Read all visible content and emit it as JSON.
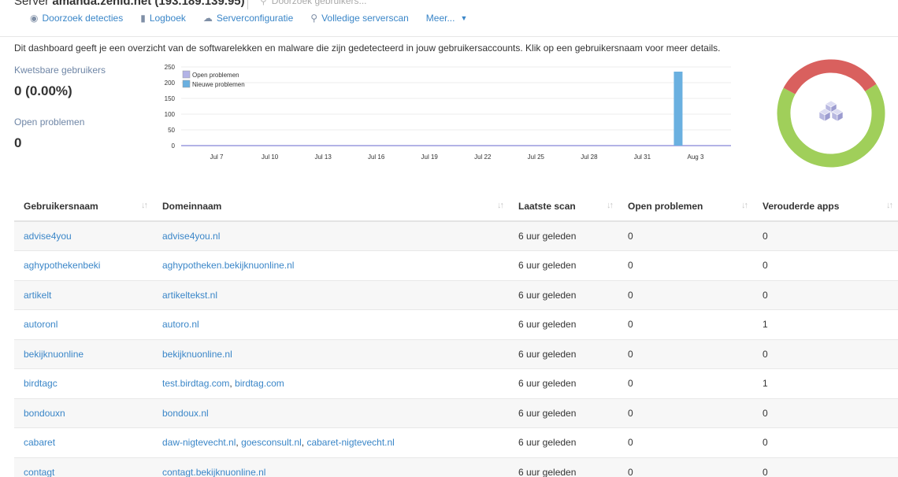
{
  "header": {
    "server_prefix": "Server ",
    "server_name": "amanda.zenid.net (193.189.139.95)",
    "search_placeholder": "Doorzoek gebruikers...",
    "nav": [
      {
        "label": "Doorzoek detecties",
        "icon": "eye-icon"
      },
      {
        "label": "Logboek",
        "icon": "book-icon"
      },
      {
        "label": "Serverconfiguratie",
        "icon": "cloud-icon"
      },
      {
        "label": "Volledige serverscan",
        "icon": "search-icon"
      },
      {
        "label": "Meer...",
        "icon": "caret-down-icon"
      }
    ]
  },
  "intro": "Dit dashboard geeft je een overzicht van de softwarelekken en malware die zijn gedetecteerd in jouw gebruikersaccounts. Klik op een gebruikersnaam voor meer details.",
  "stats": {
    "vulnerable_label": "Kwetsbare gebruikers",
    "vulnerable_value": "0 (0.00%)",
    "open_label": "Open problemen",
    "open_value": "0"
  },
  "colors": {
    "link": "#3a86c8",
    "open_series": "#b3b3e6",
    "new_series": "#6ab0e0",
    "donut_green": "#a0cf5a",
    "donut_red": "#d9605e"
  },
  "chart_data": {
    "type": "bar",
    "title": "",
    "ylim": [
      0,
      250
    ],
    "yticks": [
      0,
      50,
      100,
      150,
      200,
      250
    ],
    "xticks": [
      "Jul 7",
      "Jul 10",
      "Jul 13",
      "Jul 16",
      "Jul 19",
      "Jul 22",
      "Jul 25",
      "Jul 28",
      "Jul 31",
      "Aug 3"
    ],
    "legend_position": "top-left",
    "series": [
      {
        "name": "Open problemen",
        "points": [
          {
            "x": "Jul 5",
            "y": 0
          },
          {
            "x": "Aug 5",
            "y": 0
          }
        ]
      },
      {
        "name": "Nieuwe problemen",
        "points": [
          {
            "x": "Aug 2",
            "y": 235
          }
        ]
      }
    ]
  },
  "donut_data": {
    "type": "pie",
    "segments": [
      {
        "label": "green",
        "value": 67
      },
      {
        "label": "red",
        "value": 33
      }
    ],
    "center_icon": "cubes-icon"
  },
  "table": {
    "columns": [
      "Gebruikersnaam",
      "Domeinnaam",
      "Laatste scan",
      "Open problemen",
      "Verouderde apps"
    ],
    "rows": [
      {
        "user": "advise4you",
        "domains": [
          "advise4you.nl"
        ],
        "scan": "6 uur geleden",
        "open": "0",
        "outdated": "0"
      },
      {
        "user": "aghypothekenbeki",
        "domains": [
          "aghypotheken.bekijknuonline.nl"
        ],
        "scan": "6 uur geleden",
        "open": "0",
        "outdated": "0"
      },
      {
        "user": "artikelt",
        "domains": [
          "artikeltekst.nl"
        ],
        "scan": "6 uur geleden",
        "open": "0",
        "outdated": "0"
      },
      {
        "user": "autoronl",
        "domains": [
          "autoro.nl"
        ],
        "scan": "6 uur geleden",
        "open": "0",
        "outdated": "1"
      },
      {
        "user": "bekijknuonline",
        "domains": [
          "bekijknuonline.nl"
        ],
        "scan": "6 uur geleden",
        "open": "0",
        "outdated": "0"
      },
      {
        "user": "birdtagc",
        "domains": [
          "test.birdtag.com",
          "birdtag.com"
        ],
        "scan": "6 uur geleden",
        "open": "0",
        "outdated": "1"
      },
      {
        "user": "bondouxn",
        "domains": [
          "bondoux.nl"
        ],
        "scan": "6 uur geleden",
        "open": "0",
        "outdated": "0"
      },
      {
        "user": "cabaret",
        "domains": [
          "daw-nigtevecht.nl",
          "goesconsult.nl",
          "cabaret-nigtevecht.nl"
        ],
        "scan": "6 uur geleden",
        "open": "0",
        "outdated": "0"
      },
      {
        "user": "contagt",
        "domains": [
          "contagt.bekijknuonline.nl"
        ],
        "scan": "6 uur geleden",
        "open": "0",
        "outdated": "0"
      }
    ]
  }
}
